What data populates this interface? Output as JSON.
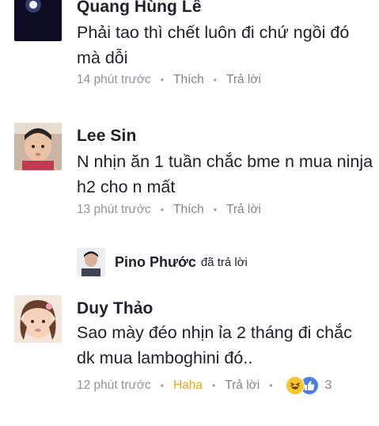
{
  "comments": [
    {
      "author": "Quang Hùng Lê",
      "text": "Phải tao thì chết luôn đi chứ ngồi đó mà dỗi",
      "time": "14 phút trước",
      "like_label": "Thích",
      "reply_label": "Trả lời"
    },
    {
      "author": "Lee Sin",
      "text": "N nhịn ăn 1 tuần chắc bme n mua ninja h2 cho n mất",
      "time": "13 phút trước",
      "like_label": "Thích",
      "reply_label": "Trả lời"
    },
    {
      "author": "Duy Thảo",
      "text": "Sao mày đéo nhịn ỉa 2 tháng đi chắc dk mua lamboghini đó..",
      "time": "12 phút trước",
      "like_label": "Haha",
      "reply_label": "Trả lời",
      "reaction_count": "3",
      "reaction_icons": [
        "haha-icon",
        "like-icon"
      ]
    }
  ],
  "reply_summary": {
    "name": "Pino Phước",
    "suffix": "đã trả lời"
  },
  "colors": {
    "text": "#1d2129",
    "meta": "#90949c",
    "haha": "#e7a81a",
    "like_blue": "#4a7fe6",
    "haha_yellow": "#f7c62e"
  }
}
